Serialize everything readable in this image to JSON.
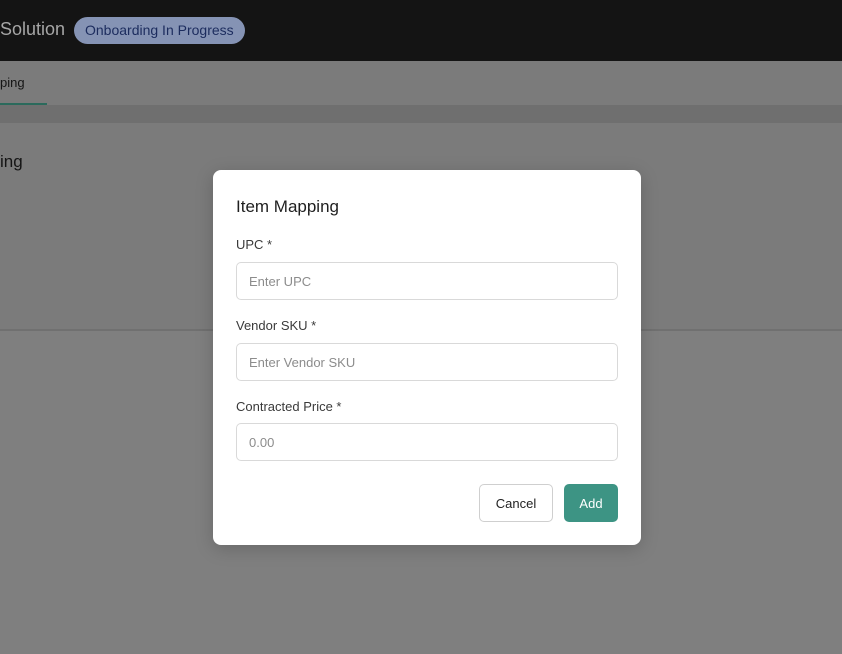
{
  "header": {
    "app_title": "Solution",
    "status_badge": "Onboarding In Progress"
  },
  "tabs": {
    "active_label": "ping"
  },
  "card": {
    "title": "ing"
  },
  "modal": {
    "title": "Item Mapping",
    "fields": [
      {
        "label": "UPC *",
        "value": "",
        "placeholder": "Enter UPC"
      },
      {
        "label": "Vendor SKU *",
        "value": "",
        "placeholder": "Enter Vendor SKU"
      },
      {
        "label": "Contracted Price *",
        "value": "",
        "placeholder": "0.00"
      }
    ],
    "cancel_label": "Cancel",
    "add_label": "Add"
  },
  "colors": {
    "accent": "#3d9484",
    "overlay": "#7f7f7f",
    "topbar": "#141414",
    "badge_bg": "#8593b4"
  }
}
